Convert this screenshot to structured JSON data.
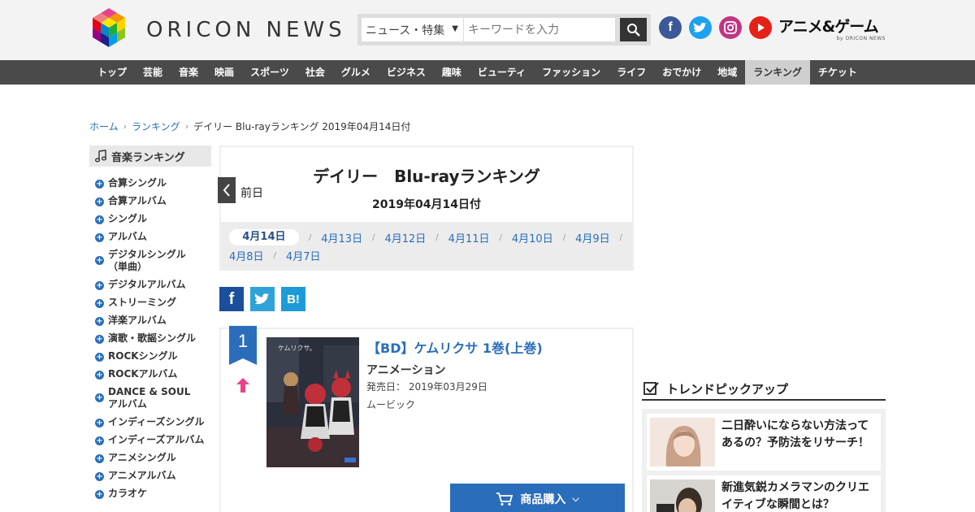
{
  "header": {
    "logo_text": "ORICON NEWS",
    "search_category": "ニュース・特集",
    "search_placeholder": "キーワードを入力",
    "anime_logo": "アニメ&ゲーム",
    "anime_by": "by ORICON NEWS"
  },
  "nav": {
    "items": [
      "トップ",
      "芸能",
      "音楽",
      "映画",
      "スポーツ",
      "社会",
      "グルメ",
      "ビジネス",
      "趣味",
      "ビューティ",
      "ファッション",
      "ライフ",
      "おでかけ",
      "地域",
      "ランキング",
      "チケット"
    ],
    "active": "ランキング"
  },
  "breadcrumb": {
    "home": "ホーム",
    "ranking": "ランキング",
    "current": "デイリー Blu-rayランキング 2019年04月14日付"
  },
  "sidebar": {
    "heading": "音楽ランキング",
    "items": [
      "合算シングル",
      "合算アルバム",
      "シングル",
      "アルバム",
      "デジタルシングル（単曲）",
      "デジタルアルバム",
      "ストリーミング",
      "洋楽アルバム",
      "演歌・歌謡シングル",
      "ROCKシングル",
      "ROCKアルバム",
      "DANCE & SOULアルバム",
      "インディーズシングル",
      "インディーズアルバム",
      "アニメシングル",
      "アニメアルバム",
      "カラオケ"
    ]
  },
  "ranking": {
    "title": "デイリー　Blu-rayランキング",
    "date": "2019年04月14日付",
    "prev_label": "前日",
    "dates": [
      "4月14日",
      "4月13日",
      "4月12日",
      "4月11日",
      "4月10日",
      "4月9日",
      "4月8日",
      "4月7日"
    ],
    "current_date": "4月14日"
  },
  "share": {
    "facebook": "f",
    "twitter": "t",
    "hatena": "B!"
  },
  "item": {
    "rank": "1",
    "title": "【BD】ケムリクサ 1巻(上巻)",
    "genre": "アニメーション",
    "release": "発売日： 2019年03月29日",
    "label": "ムービック",
    "buy_label": "商品購入",
    "jacket_text": "ケムリクサ。",
    "trend": "up"
  },
  "trend": {
    "heading": "トレンドピックアップ",
    "items": [
      {
        "title": "二日酔いにならない方法ってあるの？予防法をリサーチ！"
      },
      {
        "title": "新進気鋭カメラマンのクリエイティブな瞬間とは？"
      }
    ]
  },
  "colors": {
    "link": "#2a6ebb",
    "nav_bg": "#4a4a4a",
    "buy_button": "#2a6ebb",
    "rank_badge": "#2a6ebb",
    "up_arrow": "#e8438a"
  }
}
